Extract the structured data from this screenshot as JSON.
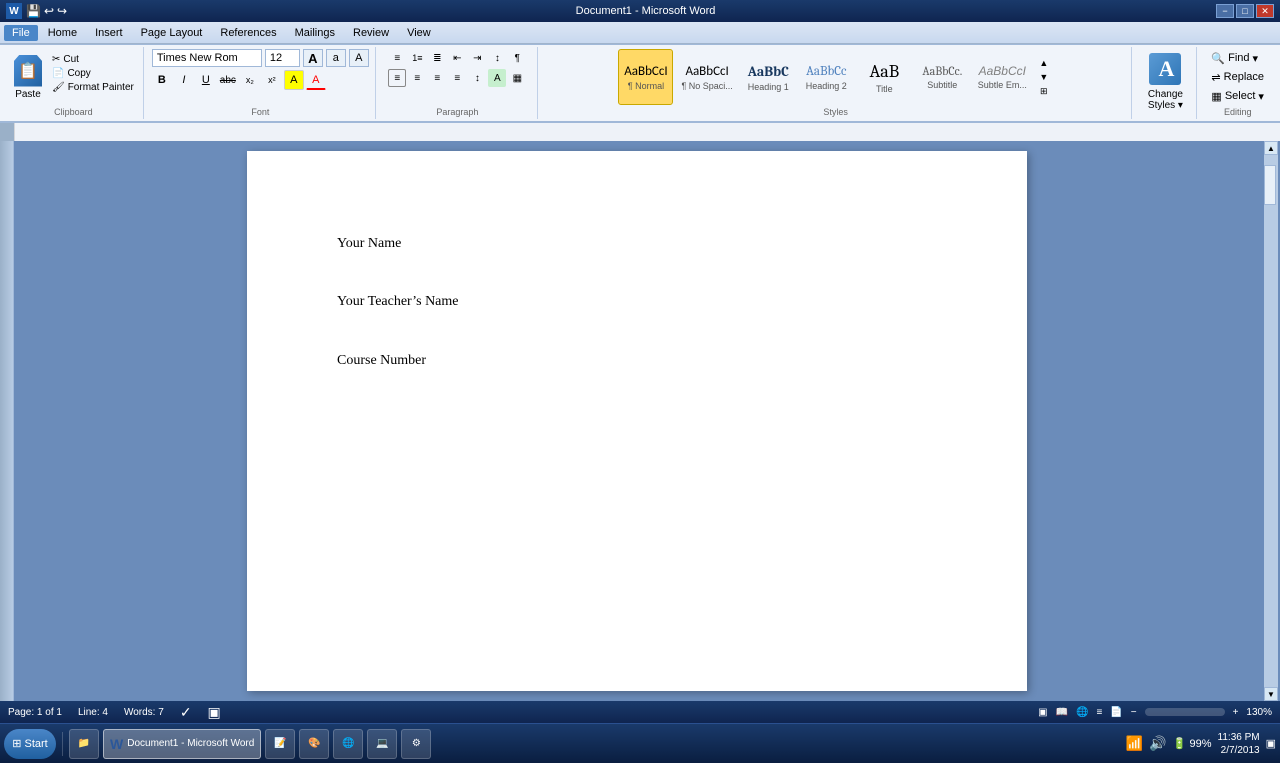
{
  "titlebar": {
    "title": "Document1 - Microsoft Word",
    "minimize": "−",
    "maximize": "□",
    "close": "✕"
  },
  "quickaccess": {
    "save": "💾",
    "undo": "↩",
    "redo": "↪"
  },
  "menubar": {
    "items": [
      "File",
      "Home",
      "Insert",
      "Page Layout",
      "References",
      "Mailings",
      "Review",
      "View"
    ]
  },
  "ribbon": {
    "groups": {
      "clipboard": {
        "label": "Clipboard",
        "paste_label": "Paste",
        "cut_label": "Cut",
        "copy_label": "Copy",
        "format_painter_label": "Format Painter"
      },
      "font": {
        "label": "Font",
        "font_name": "Times New Rom",
        "font_size": "12",
        "grow_label": "A",
        "shrink_label": "a",
        "clear_label": "A",
        "bold": "B",
        "italic": "I",
        "underline": "U",
        "strikethrough": "abc",
        "subscript": "x₂",
        "superscript": "x²"
      },
      "paragraph": {
        "label": "Paragraph",
        "bullets": "≡",
        "numbering": "1.",
        "multilevel": "≣",
        "decrease_indent": "⇤",
        "increase_indent": "⇥",
        "sort": "↕",
        "show_marks": "¶",
        "align_left": "≡",
        "align_center": "≡",
        "align_right": "≡",
        "justify": "≡",
        "spacing": "↕",
        "shading": "A",
        "borders": "□"
      },
      "styles": {
        "label": "Styles",
        "items": [
          {
            "id": "normal",
            "preview": "AaBbCcI",
            "label": "¶ Normal",
            "active": true
          },
          {
            "id": "no-spacing",
            "preview": "AaBbCcI",
            "label": "¶ No Spaci..."
          },
          {
            "id": "heading1",
            "preview": "AaBbC",
            "label": "Heading 1"
          },
          {
            "id": "heading2",
            "preview": "AaBbCc",
            "label": "Heading 2"
          },
          {
            "id": "title",
            "preview": "AaB",
            "label": "Title"
          },
          {
            "id": "subtitle",
            "preview": "AaBbCc.",
            "label": "Subtitle"
          },
          {
            "id": "subtle-em",
            "preview": "AaBbCcI",
            "label": "Subtle Em..."
          }
        ]
      },
      "change_styles": {
        "label": "Change\nStyles",
        "icon": "A"
      },
      "editing": {
        "label": "Editing",
        "find": "Find",
        "replace": "Replace",
        "select": "Select"
      }
    }
  },
  "document": {
    "lines": [
      "Your Name",
      "",
      "Your Teacher’s Name",
      "",
      "Course Number"
    ]
  },
  "statusbar": {
    "page": "Page: 1 of 1",
    "line": "Line: 4",
    "words": "Words: 7",
    "zoom": "130%"
  },
  "taskbar": {
    "start_label": "Start",
    "windows_btn": "⊞",
    "apps": [
      {
        "id": "word",
        "label": "W",
        "active": true,
        "title": "Document1 - Microsoft Word"
      },
      {
        "id": "explorer",
        "label": "📁"
      },
      {
        "id": "notepad",
        "label": "📝"
      },
      {
        "id": "paint",
        "label": "🎨"
      },
      {
        "id": "chrome",
        "label": "🌐"
      },
      {
        "id": "settings",
        "label": "⚙"
      },
      {
        "id": "cmd",
        "label": "💻"
      }
    ],
    "clock": {
      "time": "11:36 PM",
      "date": "2/7/2013"
    }
  }
}
